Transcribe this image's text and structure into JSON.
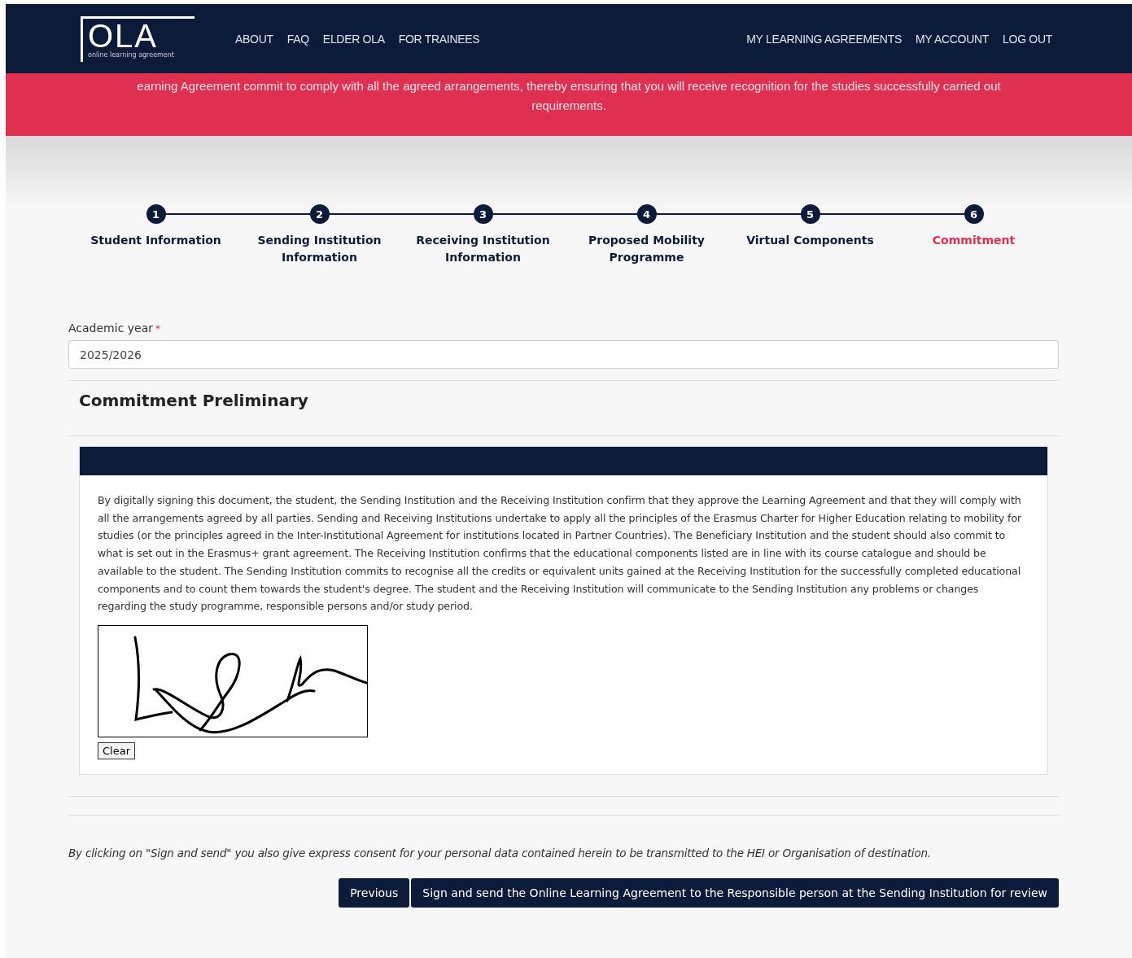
{
  "header": {
    "logo": {
      "title": "OLA",
      "subtitle": "online learning agreement"
    },
    "nav_left": [
      "ABOUT",
      "FAQ",
      "ELDER OLA",
      "FOR TRAINEES"
    ],
    "nav_right": [
      "MY LEARNING AGREEMENTS",
      "MY ACCOUNT",
      "LOG OUT"
    ]
  },
  "banner": {
    "lines": [
      "earning Agreement commit to comply with all the agreed arrangements, thereby ensuring that you will receive recognition for the studies successfully carried out",
      "requirements."
    ]
  },
  "steps": [
    {
      "number": "1",
      "label": "Student Information",
      "selected": false
    },
    {
      "number": "2",
      "label": "Sending Institution Information",
      "selected": false
    },
    {
      "number": "3",
      "label": "Receiving Institution Information",
      "selected": false
    },
    {
      "number": "4",
      "label": "Proposed Mobility Programme",
      "selected": false
    },
    {
      "number": "5",
      "label": "Virtual Components",
      "selected": false
    },
    {
      "number": "6",
      "label": "Commitment",
      "selected": true
    }
  ],
  "academic_year": {
    "label": "Academic year",
    "required_mark": "*",
    "value": "2025/2026"
  },
  "section_title": "Commitment Preliminary",
  "commitment_text": "By digitally signing this document, the student, the Sending Institution and the Receiving Institution confirm that they approve the Learning Agreement and that they will comply with all the arrangements agreed by all parties. Sending and Receiving Institutions undertake to apply all the principles of the Erasmus Charter for Higher Education relating to mobility for studies (or the principles agreed in the Inter-Institutional Agreement for institutions located in Partner Countries). The Beneficiary Institution and the student should also commit to what is set out in the Erasmus+ grant agreement. The Receiving Institution confirms that the educational components listed are in line with its course catalogue and should be available to the student. The Sending Institution commits to recognise all the credits or equivalent units gained at the Receiving Institution for the successfully completed educational components and to count them towards the student's degree. The student and the Receiving Institution will communicate to the Sending Institution any problems or changes regarding the study programme, responsible persons and/or study period.",
  "signature": {
    "clear_button": "Clear"
  },
  "consent_note": "By clicking on \"Sign and send\" you also give express consent for your personal data contained herein to be transmitted to the HEI or Organisation of destination.",
  "buttons": [
    "Previous",
    "Sign and send the Online Learning Agreement to the Responsible person at the Sending Institution for review"
  ]
}
